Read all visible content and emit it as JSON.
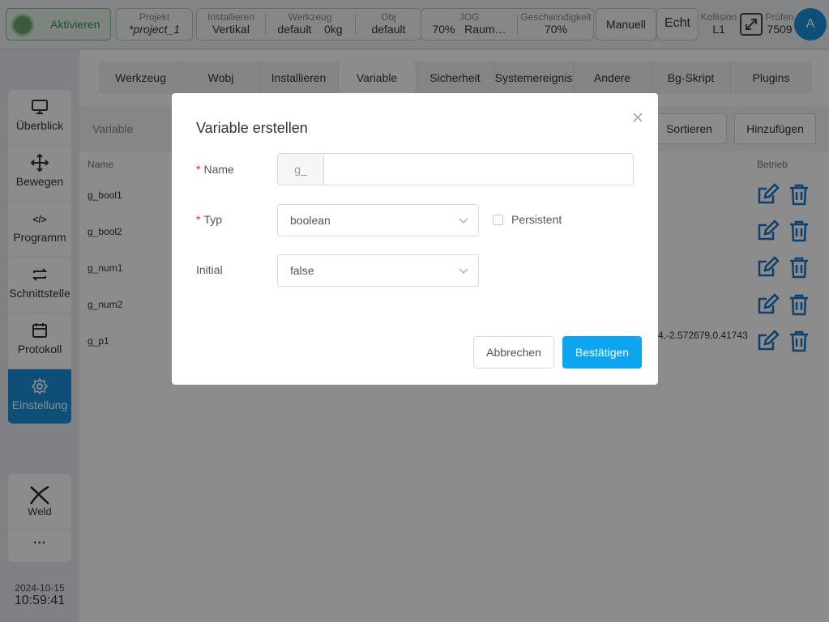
{
  "topbar": {
    "activate_label": "Aktivieren",
    "project": {
      "label": "Projekt",
      "value": "*project_1"
    },
    "install": {
      "label": "Installieren",
      "value": "Vertikal"
    },
    "tool": {
      "label": "Werkzeug",
      "value": "default",
      "extra": "0kg"
    },
    "obj": {
      "label": "Obj",
      "value": "default"
    },
    "jog": {
      "label": "JOG",
      "value": "70%",
      "extra": "Raum…"
    },
    "speed": {
      "label": "Geschwindigkeit",
      "value": "70%"
    },
    "manual_label": "Manuell",
    "real_label": "Echt",
    "collision": {
      "label": "Kollision",
      "value": "L1"
    },
    "check": {
      "label": "Prüfen",
      "value": "7509"
    },
    "avatar_letter": "A"
  },
  "sidebar": {
    "items": [
      {
        "label": "Überblick",
        "icon": "monitor-icon"
      },
      {
        "label": "Bewegen",
        "icon": "move-icon"
      },
      {
        "label": "Programm",
        "icon": "code-icon"
      },
      {
        "label": "Schnittstelle",
        "icon": "swap-icon"
      },
      {
        "label": "Protokoll",
        "icon": "calendar-icon"
      },
      {
        "label": "Einstellung",
        "icon": "gear-icon"
      }
    ],
    "weld_label": "Weld",
    "more_label": "···"
  },
  "datetime": {
    "date": "2024-10-15",
    "time": "10:59:41"
  },
  "tabs": [
    "Werkzeug",
    "Wobj",
    "Installieren",
    "Variable",
    "Sicherheit",
    "Systemereignis",
    "Andere",
    "Bg-Skript",
    "Plugins"
  ],
  "toolbar": {
    "title": "Variable",
    "sort_label": "Sortieren",
    "add_label": "Hinzufügen"
  },
  "table": {
    "col_name": "Name",
    "col_ops": "Betrieb",
    "rows": [
      {
        "name": "g_bool1",
        "value": ""
      },
      {
        "name": "g_bool2",
        "value": ""
      },
      {
        "name": "g_num1",
        "value": ""
      },
      {
        "name": "g_num2",
        "value": ""
      },
      {
        "name": "g_p1",
        "value": "4,-2.572679,0.41743"
      }
    ]
  },
  "modal": {
    "title": "Variable erstellen",
    "required_mark": "*",
    "name_label": "Name",
    "name_prefix": "g_",
    "name_value": "",
    "type_label": "Typ",
    "type_value": "boolean",
    "persistent_label": "Persistent",
    "initial_label": "Initial",
    "initial_value": "false",
    "cancel_label": "Abbrechen",
    "confirm_label": "Bestätigen"
  },
  "colors": {
    "accent": "#1890d8",
    "confirm": "#0ea5f0",
    "required": "#f5222d",
    "icon_blue": "#1677c8"
  }
}
